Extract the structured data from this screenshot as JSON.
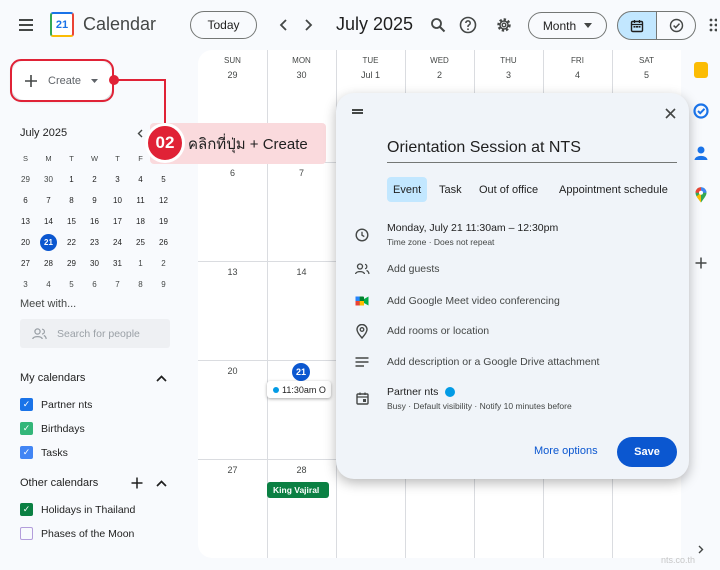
{
  "header": {
    "app_title": "Calendar",
    "logo_number": "21",
    "today_label": "Today",
    "month_title": "July 2025",
    "view_label": "Month"
  },
  "sidebar": {
    "create_label": "Create",
    "mini_month_title": "July 2025",
    "mini_dows": [
      "S",
      "M",
      "T",
      "W",
      "T",
      "F",
      "S"
    ],
    "mini_weeks": [
      [
        "29",
        "30",
        "1",
        "2",
        "3",
        "4",
        "5"
      ],
      [
        "6",
        "7",
        "8",
        "9",
        "10",
        "11",
        "12"
      ],
      [
        "13",
        "14",
        "15",
        "16",
        "17",
        "18",
        "19"
      ],
      [
        "20",
        "21",
        "22",
        "23",
        "24",
        "25",
        "26"
      ],
      [
        "27",
        "28",
        "29",
        "30",
        "31",
        "1",
        "2"
      ],
      [
        "3",
        "4",
        "5",
        "6",
        "7",
        "8",
        "9"
      ]
    ],
    "meet_label": "Meet with...",
    "search_placeholder": "Search for people",
    "my_calendars_title": "My calendars",
    "my_calendars": [
      {
        "label": "Partner nts",
        "color": "#1a73e8"
      },
      {
        "label": "Birthdays",
        "color": "#33b679"
      },
      {
        "label": "Tasks",
        "color": "#4285f4"
      }
    ],
    "other_calendars_title": "Other calendars",
    "other_calendars": [
      {
        "label": "Holidays in Thailand",
        "color": "#0b8043",
        "checked": true
      },
      {
        "label": "Phases of the Moon",
        "color": "#b39ddb",
        "checked": false
      }
    ]
  },
  "grid": {
    "dows": [
      "SUN",
      "MON",
      "TUE",
      "WED",
      "THU",
      "FRI",
      "SAT"
    ],
    "first_row_dates": [
      "29",
      "30",
      "Jul 1",
      "2",
      "3",
      "4",
      "5"
    ],
    "col0_dates": [
      "6",
      "13",
      "20",
      "27"
    ],
    "col1_dates": [
      "7",
      "14",
      "21",
      "28"
    ],
    "event_time_chip": "11:30am O",
    "holiday_chip": "King Vajiral"
  },
  "callout": {
    "number": "02",
    "text": "คลิกที่ปุ่ม + Create"
  },
  "dialog": {
    "title": "Orientation Session at NTS",
    "tabs": [
      "Event",
      "Task",
      "Out of office",
      "Appointment schedule"
    ],
    "date_time": "Monday, July 21    11:30am  –  12:30pm",
    "time_sub": "Time zone · Does not repeat",
    "add_guests": "Add guests",
    "add_meet": "Add Google Meet video conferencing",
    "add_rooms": "Add rooms or location",
    "add_desc": "Add description or a Google Drive attachment",
    "calendar_name": "Partner nts",
    "calendar_sub": "Busy · Default visibility · Notify 10 minutes before",
    "more_options": "More options",
    "save": "Save"
  },
  "watermark": "nts.co.th"
}
